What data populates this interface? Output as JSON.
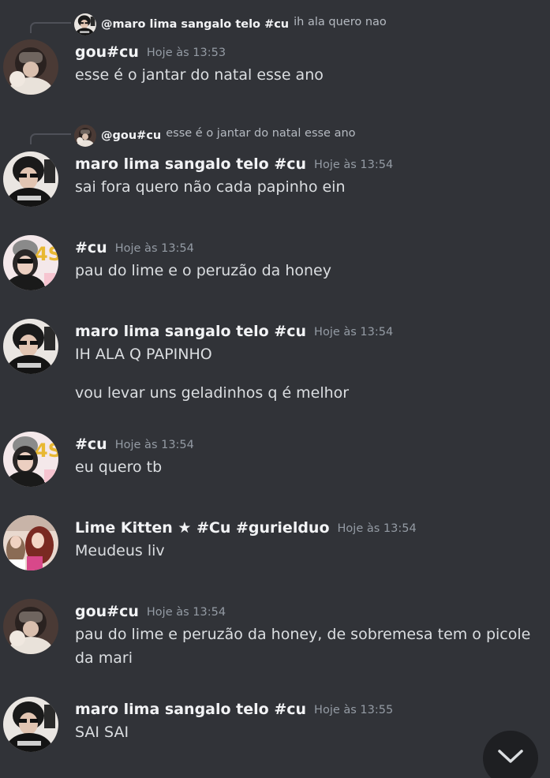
{
  "messages": [
    {
      "reply_to": {
        "name": "@maro lima sangalo telo #cu",
        "text": "ih ala quero nao"
      },
      "author": "gou#cu",
      "timestamp": "Hoje às 13:53",
      "lines": [
        "esse é o jantar do natal esse ano"
      ]
    },
    {
      "reply_to": {
        "name": "@gou#cu",
        "text": "esse é o jantar do natal esse ano"
      },
      "author": "maro lima sangalo telo #cu",
      "timestamp": "Hoje às 13:54",
      "lines": [
        "sai fora quero não cada papinho ein"
      ]
    },
    {
      "author": "#cu",
      "timestamp": "Hoje às 13:54",
      "lines": [
        "pau do lime e o peruzão da honey"
      ]
    },
    {
      "author": "maro lima sangalo telo #cu",
      "timestamp": "Hoje às 13:54",
      "lines": [
        "IH ALA Q PAPINHO",
        "vou levar uns geladinhos q é melhor"
      ]
    },
    {
      "author": "#cu",
      "timestamp": "Hoje às 13:54",
      "lines": [
        "eu quero tb"
      ]
    },
    {
      "author": "Lime Kitten ★ #Cu #gurielduo",
      "timestamp": "Hoje às 13:54",
      "lines": [
        "Meudeus liv"
      ]
    },
    {
      "author": "gou#cu",
      "timestamp": "Hoje às 13:54",
      "lines": [
        "pau do lime e peruzão da honey, de sobremesa tem o picole da mari"
      ]
    },
    {
      "author": "maro lima sangalo telo #cu",
      "timestamp": "Hoje às 13:55",
      "lines": [
        "SAI SAI"
      ]
    }
  ],
  "icons": {
    "jump": "chevron-down-icon"
  },
  "colors": {
    "background": "#313338",
    "username": "#f2f3f5",
    "message_text": "#dbdee1",
    "timestamp": "#949ba4",
    "jump_button": "#1e1f22"
  }
}
